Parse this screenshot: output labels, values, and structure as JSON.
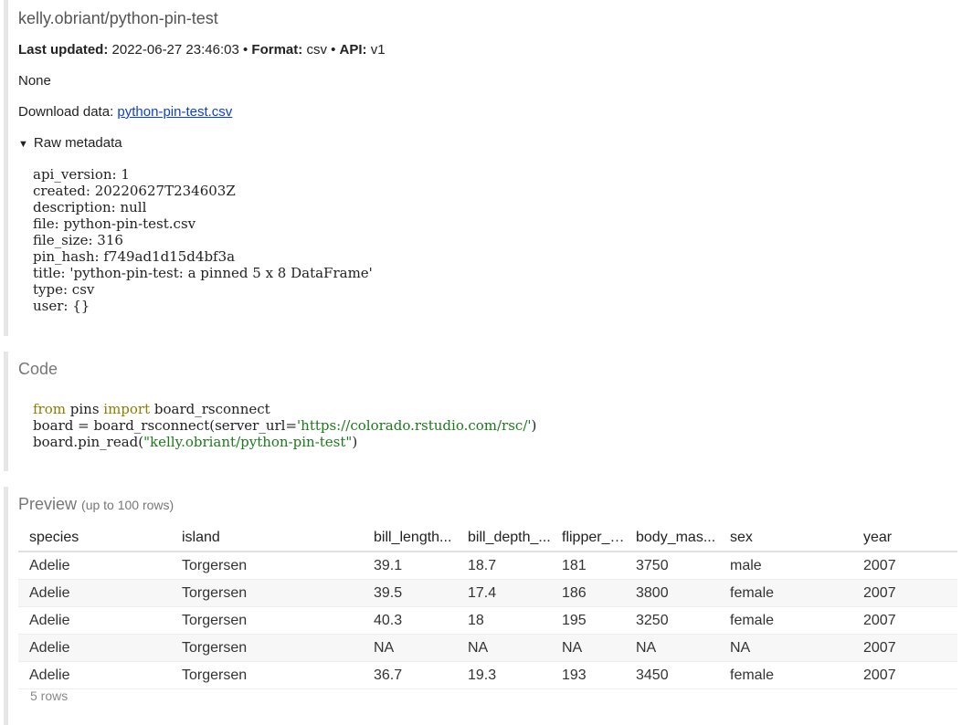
{
  "meta_section": {
    "pin_name": "kelly.obriant/python-pin-test",
    "last_updated_label": "Last updated:",
    "last_updated_value": "2022-06-27 23:46:03",
    "sep1": "•",
    "format_label": "Format:",
    "format_value": "csv",
    "sep2": "•",
    "api_label": "API:",
    "api_value": "v1",
    "description": "None",
    "download_label": "Download data:",
    "download_link": "python-pin-test.csv",
    "raw_metadata_label": "Raw metadata",
    "raw_metadata_lines": [
      "api_version: 1",
      "created: 20220627T234603Z",
      "description: null",
      "file: python-pin-test.csv",
      "file_size: 316",
      "pin_hash: f749ad1d15d4bf3a",
      "title: 'python-pin-test: a pinned 5 x 8 DataFrame'",
      "type: csv",
      "user: {}"
    ]
  },
  "code_section": {
    "title": "Code",
    "line1_kw1": "from",
    "line1_mid": " pins ",
    "line1_kw2": "import",
    "line1_end": " board_rsconnect",
    "line2_start": "board = board_rsconnect(server_url=",
    "line2_str": "'https://colorado.rstudio.com/rsc/'",
    "line2_end": ")",
    "line3_start": "board.pin_read(",
    "line3_str": "\"kelly.obriant/python-pin-test\"",
    "line3_end": ")"
  },
  "preview_section": {
    "title": "Preview",
    "subtitle": "(up to 100 rows)",
    "columns": [
      "species",
      "island",
      "bill_length...",
      "bill_depth_...",
      "flipper_l...",
      "body_mas...",
      "sex",
      "year"
    ],
    "rows": [
      [
        "Adelie",
        "Torgersen",
        "39.1",
        "18.7",
        "181",
        "3750",
        "male",
        "2007"
      ],
      [
        "Adelie",
        "Torgersen",
        "39.5",
        "17.4",
        "186",
        "3800",
        "female",
        "2007"
      ],
      [
        "Adelie",
        "Torgersen",
        "40.3",
        "18",
        "195",
        "3250",
        "female",
        "2007"
      ],
      [
        "Adelie",
        "Torgersen",
        "NA",
        "NA",
        "NA",
        "NA",
        "NA",
        "2007"
      ],
      [
        "Adelie",
        "Torgersen",
        "36.7",
        "19.3",
        "193",
        "3450",
        "female",
        "2007"
      ]
    ],
    "row_count": "5 rows"
  }
}
